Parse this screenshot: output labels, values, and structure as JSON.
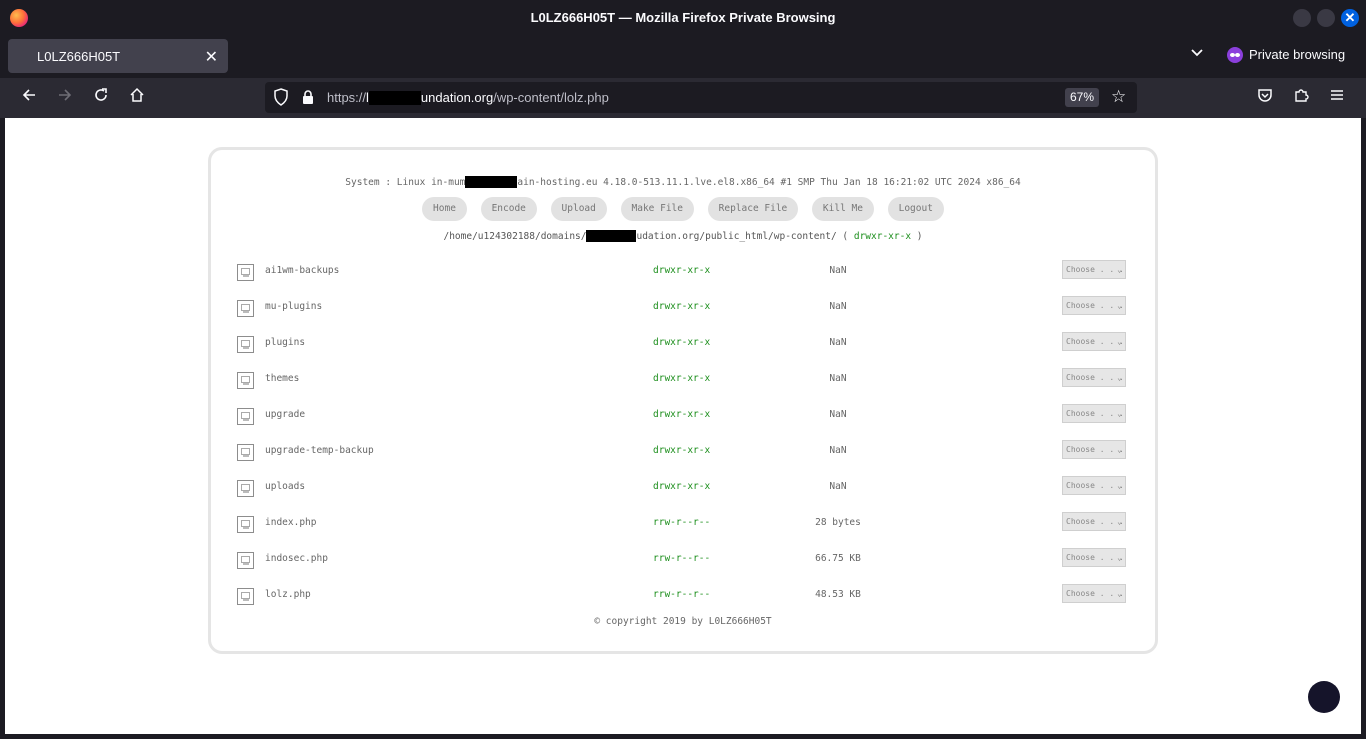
{
  "window": {
    "title": "L0LZ666H05T — Mozilla Firefox Private Browsing"
  },
  "tab": {
    "label": "L0LZ666H05T"
  },
  "private_label": "Private browsing",
  "urlbar": {
    "scheme": "https://",
    "host_prefix": "l",
    "host_suffix": "undation.org",
    "path": "/wp-content/lolz.php",
    "zoom": "67%"
  },
  "shell": {
    "system_prefix": "System : Linux in-mum",
    "system_suffix": "ain-hosting.eu 4.18.0-513.11.1.lve.el8.x86_64 #1 SMP Thu Jan 18 16:21:02 UTC 2024 x86_64",
    "menu": [
      "Home",
      "Encode",
      "Upload",
      "Make File",
      "Replace File",
      "Kill Me",
      "Logout"
    ],
    "path_prefix": "/home/u124302188/domains/",
    "path_suffix": "udation.org/public_html/wp-content/ (",
    "path_perm": "drwxr-xr-x",
    "path_close": ")",
    "select_placeholder": "Choose . . .",
    "files": [
      {
        "name": "ai1wm-backups",
        "perm": "drwxr-xr-x",
        "size": "NaN"
      },
      {
        "name": "mu-plugins",
        "perm": "drwxr-xr-x",
        "size": "NaN"
      },
      {
        "name": "plugins",
        "perm": "drwxr-xr-x",
        "size": "NaN"
      },
      {
        "name": "themes",
        "perm": "drwxr-xr-x",
        "size": "NaN"
      },
      {
        "name": "upgrade",
        "perm": "drwxr-xr-x",
        "size": "NaN"
      },
      {
        "name": "upgrade-temp-backup",
        "perm": "drwxr-xr-x",
        "size": "NaN"
      },
      {
        "name": "uploads",
        "perm": "drwxr-xr-x",
        "size": "NaN"
      },
      {
        "name": "index.php",
        "perm": "rrw-r--r--",
        "size": "28 bytes"
      },
      {
        "name": "indosec.php",
        "perm": "rrw-r--r--",
        "size": "66.75 KB"
      },
      {
        "name": "lolz.php",
        "perm": "rrw-r--r--",
        "size": "48.53 KB"
      }
    ],
    "copyright": "© copyright 2019 by L0LZ666H05T"
  }
}
